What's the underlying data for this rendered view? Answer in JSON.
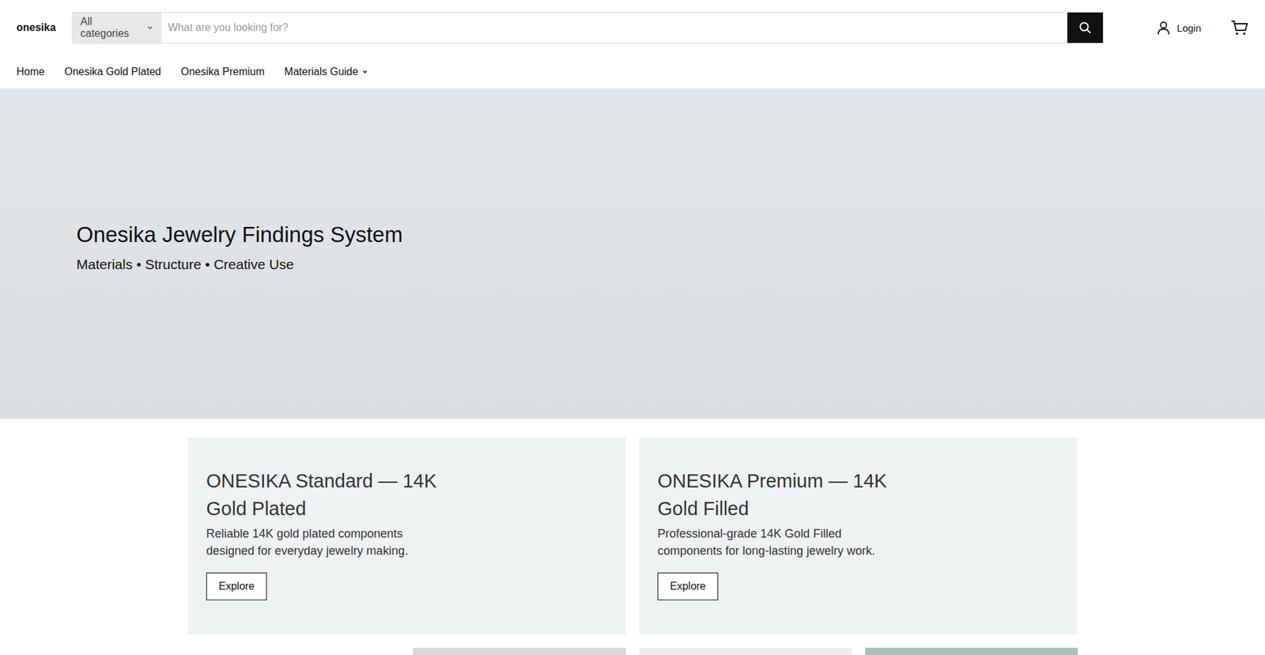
{
  "header": {
    "logo": "onesika",
    "category": "All categories",
    "search_placeholder": "What are you looking for?",
    "login": "Login"
  },
  "nav": [
    {
      "label": "Home",
      "kind": "link"
    },
    {
      "label": "Onesika Gold Plated",
      "kind": "link"
    },
    {
      "label": "Onesika Premium",
      "kind": "link"
    },
    {
      "label": "Materials Guide",
      "kind": "dropdown"
    }
  ],
  "hero": {
    "title": "Onesika Jewelry Findings System",
    "subtitle": "Materials • Structure • Creative Use"
  },
  "cards": [
    {
      "title": "ONESIKA Standard — 14K Gold Plated",
      "text": "Reliable 14K gold plated components designed for everyday jewelry making.",
      "button": "Explore"
    },
    {
      "title": "ONESIKA Premium — 14K Gold Filled",
      "text": "Professional-grade 14K Gold Filled components for long-lasting jewelry work.",
      "button": "Explore"
    }
  ]
}
